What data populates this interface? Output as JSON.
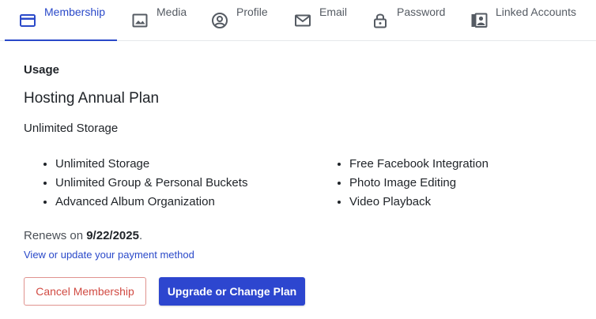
{
  "tabs": [
    {
      "label": "Membership",
      "icon": "credit-card-icon",
      "active": true
    },
    {
      "label": "Media",
      "icon": "image-icon",
      "active": false
    },
    {
      "label": "Profile",
      "icon": "user-circle-icon",
      "active": false
    },
    {
      "label": "Email",
      "icon": "envelope-icon",
      "active": false
    },
    {
      "label": "Password",
      "icon": "lock-icon",
      "active": false
    },
    {
      "label": "Linked Accounts",
      "icon": "linked-accounts-icon",
      "active": false
    }
  ],
  "usage": {
    "heading": "Usage",
    "plan_name": "Hosting Annual Plan",
    "plan_summary": "Unlimited Storage",
    "features_left": [
      "Unlimited Storage",
      "Unlimited Group & Personal Buckets",
      "Advanced Album Organization"
    ],
    "features_right": [
      "Free Facebook Integration",
      "Photo Image Editing",
      "Video Playback"
    ],
    "renew_prefix": "Renews on",
    "renew_date": "9/22/2025",
    "renew_suffix": ".",
    "payment_link": "View or update your payment method"
  },
  "actions": {
    "cancel_label": "Cancel Membership",
    "upgrade_label": "Upgrade or Change Plan"
  },
  "colors": {
    "accent": "#2a49c9",
    "primary_button": "#2d46cf",
    "danger": "#d14b43"
  }
}
